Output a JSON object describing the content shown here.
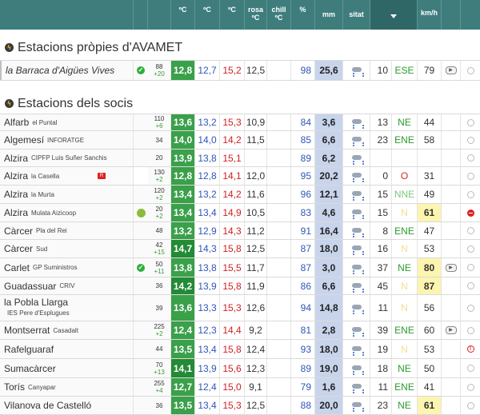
{
  "header": {
    "cols": [
      "ºC",
      "ºC",
      "ºC",
      "rosa ºC",
      "chill ºC",
      "%",
      "mm",
      "sitat",
      "",
      "km/h"
    ]
  },
  "sections": {
    "own": "Estacions pròpies d'AVAMET",
    "members": "Estacions dels socis"
  },
  "own_rows": [
    {
      "mun": "la Barraca d'Aigües Vives",
      "station": "",
      "alt": "88",
      "dalt": "+20",
      "tmax": "12,8",
      "tmed": "12,7",
      "tmin": "15,2",
      "rosa": "12,5",
      "chill": "",
      "hum": "98",
      "prec": "25,6",
      "wv": "10",
      "wd": "ESE",
      "gst": "79",
      "flag": "check",
      "cam": "camera",
      "st": "clock"
    }
  ],
  "rows": [
    {
      "mun": "Alfarb",
      "station": "el Puntal",
      "alt": "110",
      "dalt": "+6",
      "tmax": "13,6",
      "tmed": "13,2",
      "tmin": "15,3",
      "rosa": "10,9",
      "hum": "84",
      "prec": "3,6",
      "wv": "13",
      "wd": "NE",
      "gst": "44",
      "st": "clock"
    },
    {
      "mun": "Algemesí",
      "station": "INFORATGE",
      "alt": "34",
      "dalt": "",
      "tmax": "14,0",
      "tmed": "14,0",
      "tmin": "14,2",
      "rosa": "11,5",
      "hum": "85",
      "prec": "6,6",
      "wv": "23",
      "wd": "ENE",
      "gst": "58",
      "st": "clock"
    },
    {
      "mun": "Alzira",
      "station": "CIPFP Luis Suñer Sanchis",
      "alt": "20",
      "dalt": "",
      "tmax": "13,9",
      "tmed": "13,8",
      "tmin": "15,1",
      "rosa": "",
      "hum": "89",
      "prec": "6,2",
      "wv": "",
      "wd": "",
      "gst": "",
      "st": "clock"
    },
    {
      "mun": "Alzira",
      "station": "la Casella",
      "alt": "130",
      "dalt": "+2",
      "tmax": "12,8",
      "tmed": "12,8",
      "tmin": "14,1",
      "rosa": "12,0",
      "hum": "95",
      "prec": "20,2",
      "wv": "0",
      "wd": "O",
      "gst": "31",
      "flag": "rbadge",
      "wdc": "red",
      "st": "clock"
    },
    {
      "mun": "Alzira",
      "station": "la Murta",
      "alt": "120",
      "dalt": "+2",
      "tmax": "13,4",
      "tmed": "13,2",
      "tmin": "14,2",
      "rosa": "11,6",
      "hum": "96",
      "prec": "12,1",
      "wv": "15",
      "wd": "NNE",
      "gst": "49",
      "wdc": "lite",
      "st": "clock"
    },
    {
      "mun": "Alzira",
      "station": "Mulata Aizicoop",
      "alt": "20",
      "dalt": "+2",
      "tmax": "13,4",
      "tmed": "13,4",
      "tmin": "14,9",
      "rosa": "10,5",
      "hum": "83",
      "prec": "4,6",
      "wv": "15",
      "wd": "N",
      "gst": "61",
      "flag": "leaf",
      "wdc": "na",
      "gsthi": true,
      "st": "stop"
    },
    {
      "mun": "Càrcer",
      "station": "Pla del Rei",
      "alt": "48",
      "dalt": "",
      "tmax": "13,2",
      "tmed": "12,9",
      "tmin": "14,3",
      "rosa": "11,2",
      "hum": "91",
      "prec": "16,4",
      "wv": "8",
      "wd": "ENE",
      "gst": "47",
      "st": "clock"
    },
    {
      "mun": "Càrcer",
      "station": "Sud",
      "alt": "42",
      "dalt": "+15",
      "tmax": "14,7",
      "tmed": "14,3",
      "tmin": "15,8",
      "rosa": "12,5",
      "hum": "87",
      "prec": "18,0",
      "wv": "16",
      "wd": "N",
      "gst": "53",
      "dk": true,
      "wdc": "na",
      "st": "clock"
    },
    {
      "mun": "Carlet",
      "station": "GP Suministros",
      "alt": "50",
      "dalt": "+11",
      "tmax": "13,8",
      "tmed": "13,8",
      "tmin": "15,5",
      "rosa": "11,7",
      "hum": "87",
      "prec": "3,0",
      "wv": "37",
      "wd": "NE",
      "gst": "80",
      "flag": "check",
      "gsthi": true,
      "cam": "camera",
      "st": "clock"
    },
    {
      "mun": "Guadassuar",
      "station": "CRIV",
      "alt": "36",
      "dalt": "",
      "tmax": "14,2",
      "tmed": "13,9",
      "tmin": "15,8",
      "rosa": "11,9",
      "hum": "86",
      "prec": "6,6",
      "wv": "45",
      "wd": "N",
      "gst": "87",
      "dk": true,
      "wdc": "na",
      "gsthi": true,
      "st": "clock"
    },
    {
      "mun": "la Pobla Llarga",
      "station": "IES Pere d'Esplugues",
      "alt": "39",
      "dalt": "",
      "tmax": "13,6",
      "tmed": "13,3",
      "tmin": "15,3",
      "rosa": "12,6",
      "hum": "94",
      "prec": "14,8",
      "wv": "11",
      "wd": "N",
      "gst": "56",
      "wdc": "na",
      "two": true,
      "st": "clock"
    },
    {
      "mun": "Montserrat",
      "station": "Casadalt",
      "alt": "225",
      "dalt": "+2",
      "tmax": "12,4",
      "tmed": "12,3",
      "tmin": "14,4",
      "rosa": "9,2",
      "hum": "81",
      "prec": "2,8",
      "wv": "39",
      "wd": "ENE",
      "gst": "60",
      "cam": "camera",
      "st": "clock"
    },
    {
      "mun": "Rafelguaraf",
      "station": "",
      "alt": "44",
      "dalt": "",
      "tmax": "13,5",
      "tmed": "13,4",
      "tmin": "15,8",
      "rosa": "12,4",
      "hum": "93",
      "prec": "18,0",
      "wv": "19",
      "wd": "N",
      "gst": "53",
      "wdc": "na",
      "st": "warn"
    },
    {
      "mun": "Sumacàrcer",
      "station": "",
      "alt": "70",
      "dalt": "+13",
      "tmax": "14,1",
      "tmed": "13,9",
      "tmin": "15,6",
      "rosa": "12,3",
      "hum": "89",
      "prec": "19,0",
      "wv": "18",
      "wd": "NE",
      "gst": "50",
      "dk": true,
      "st": "clock"
    },
    {
      "mun": "Torís",
      "station": "Canyapar",
      "alt": "255",
      "dalt": "+4",
      "tmax": "12,7",
      "tmed": "12,4",
      "tmin": "15,0",
      "rosa": "9,1",
      "hum": "79",
      "prec": "1,6",
      "wv": "11",
      "wd": "ENE",
      "gst": "41",
      "st": "clock"
    },
    {
      "mun": "Vilanova de Castelló",
      "station": "",
      "alt": "36",
      "dalt": "",
      "tmax": "13,5",
      "tmed": "13,4",
      "tmin": "15,3",
      "rosa": "12,5",
      "hum": "88",
      "prec": "20,0",
      "wv": "23",
      "wd": "NE",
      "gst": "61",
      "gsthi": true,
      "st": "clock"
    }
  ]
}
